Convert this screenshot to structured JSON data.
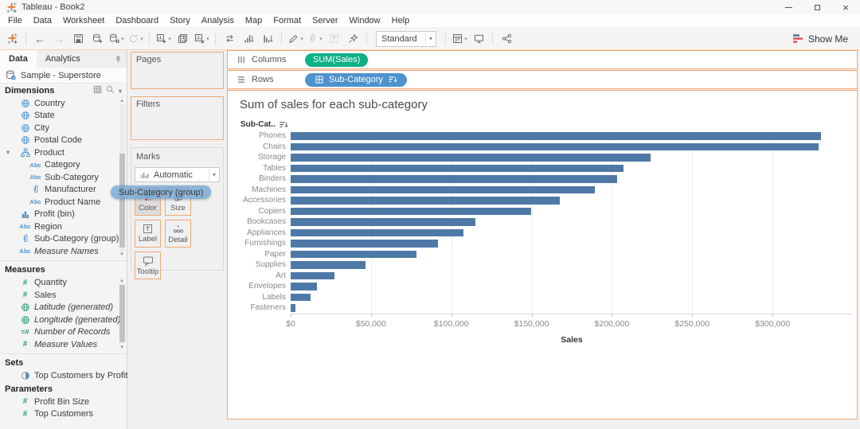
{
  "window": {
    "title": "Tableau - Book2",
    "controls": [
      "minimize-icon",
      "restore-icon",
      "close-icon"
    ]
  },
  "menu": {
    "items": [
      "File",
      "Data",
      "Worksheet",
      "Dashboard",
      "Story",
      "Analysis",
      "Map",
      "Format",
      "Server",
      "Window",
      "Help"
    ]
  },
  "toolbar": {
    "left_buttons": [
      {
        "name": "tableau-home",
        "icon": "tableau-logo-icon"
      },
      {
        "name": "back",
        "icon": "back-icon",
        "sep_before": true
      },
      {
        "name": "forward",
        "icon": "forward-icon",
        "disabled": true
      },
      {
        "name": "save",
        "icon": "save-icon"
      },
      {
        "name": "add-datasource",
        "icon": "add-datasource-icon"
      },
      {
        "name": "pause-updates",
        "icon": "pause-updates-icon",
        "caret": true
      },
      {
        "name": "refresh",
        "icon": "refresh-icon",
        "caret": true,
        "disabled": true
      },
      {
        "name": "new-worksheet",
        "icon": "new-worksheet-icon",
        "caret": true,
        "sep_before": true
      },
      {
        "name": "duplicate-sheet",
        "icon": "duplicate-sheet-icon"
      },
      {
        "name": "clear-sheet",
        "icon": "clear-sheet-icon",
        "caret": true
      },
      {
        "name": "swap-rows-columns",
        "icon": "swap-icon",
        "sep_before": true
      },
      {
        "name": "sort-ascending",
        "icon": "sort-ascending-icon"
      },
      {
        "name": "sort-descending",
        "icon": "sort-descending-icon"
      },
      {
        "name": "highlight",
        "icon": "highlight-icon",
        "caret": true,
        "sep_before": true
      },
      {
        "name": "group-members",
        "icon": "paperclip-icon",
        "caret": true,
        "disabled": true
      },
      {
        "name": "show-mark-labels",
        "icon": "show-mark-labels-icon",
        "disabled": true
      },
      {
        "name": "fix-axes",
        "icon": "pin-icon"
      }
    ],
    "fit_mode": {
      "value": "Standard"
    },
    "right_buttons": [
      {
        "name": "show-hide-cards",
        "icon": "show-hide-cards-icon",
        "caret": true
      },
      {
        "name": "presentation-mode",
        "icon": "presentation-mode-icon"
      },
      {
        "name": "share-workbook",
        "icon": "share-icon",
        "sep_before": true
      }
    ],
    "show_me_label": "Show Me"
  },
  "data_pane": {
    "tabs": [
      {
        "label": "Data",
        "active": true
      },
      {
        "label": "Analytics",
        "active": false
      }
    ],
    "connection": {
      "icon": "datasource-icon",
      "name": "Sample - Superstore"
    },
    "dimensions": {
      "title": "Dimensions",
      "header_icons": [
        "view-as-grid-icon",
        "find-field-icon",
        "pane-menu-icon"
      ],
      "items": [
        {
          "icon": "geographic-icon",
          "label": "Country"
        },
        {
          "icon": "geographic-icon",
          "label": "State"
        },
        {
          "icon": "geographic-icon",
          "label": "City"
        },
        {
          "icon": "geographic-icon",
          "label": "Postal Code"
        },
        {
          "icon": "hierarchy-icon",
          "label": "Product",
          "expander": true
        },
        {
          "icon": "string-icon",
          "label": "Category",
          "indent": true
        },
        {
          "icon": "string-icon",
          "label": "Sub-Category",
          "indent": true
        },
        {
          "icon": "paperclip-blue-icon",
          "label": "Manufacturer",
          "indent": true
        },
        {
          "icon": "string-icon",
          "label": "Product Name",
          "indent": true
        },
        {
          "icon": "bin-icon",
          "label": "Profit (bin)"
        },
        {
          "icon": "string-icon",
          "label": "Region"
        },
        {
          "icon": "paperclip-blue-icon",
          "label": "Sub-Category (group)"
        },
        {
          "icon": "string-icon",
          "label": "Measure Names",
          "italic": true
        }
      ]
    },
    "measures": {
      "title": "Measures",
      "items": [
        {
          "icon": "numeric-icon",
          "label": "Quantity"
        },
        {
          "icon": "numeric-icon",
          "label": "Sales"
        },
        {
          "icon": "geographic-gen-icon",
          "label": "Latitude (generated)",
          "italic": true
        },
        {
          "icon": "geographic-gen-icon",
          "label": "Longitude (generated)",
          "italic": true
        },
        {
          "icon": "auto-numeric-icon",
          "label": "Number of Records",
          "italic": true
        },
        {
          "icon": "numeric-icon",
          "label": "Measure Values",
          "italic": true
        }
      ]
    },
    "sets": {
      "title": "Sets",
      "items": [
        {
          "icon": "set-icon",
          "label": "Top Customers by Profit"
        }
      ]
    },
    "parameters": {
      "title": "Parameters",
      "items": [
        {
          "icon": "numeric-icon",
          "label": "Profit Bin Size"
        },
        {
          "icon": "numeric-icon",
          "label": "Top Customers"
        }
      ]
    }
  },
  "cards": {
    "pages_label": "Pages",
    "filters_label": "Filters",
    "marks": {
      "title": "Marks",
      "type_value": "Automatic",
      "buttons": [
        {
          "name": "color",
          "label": "Color",
          "icon": "color-icon",
          "active": true
        },
        {
          "name": "size",
          "label": "Size",
          "icon": "size-icon"
        },
        {
          "name": "label",
          "label": "Label",
          "icon": "label-icon"
        },
        {
          "name": "detail",
          "label": "Detail",
          "icon": "detail-icon"
        },
        {
          "name": "tooltip",
          "label": "Tooltip",
          "icon": "tooltip-icon"
        }
      ]
    }
  },
  "shelves": {
    "columns": {
      "label": "Columns",
      "pill": {
        "text": "SUM(Sales)",
        "kind": "measure"
      }
    },
    "rows": {
      "label": "Rows",
      "pill": {
        "text": "Sub-Category",
        "kind": "dimension",
        "sorted": true
      }
    }
  },
  "drag_pill": {
    "text": "Sub-Category (group)"
  },
  "view": {
    "title": "Sum of sales for each sub-category",
    "row_header_label": "Sub-Cat.."
  },
  "chart_data": {
    "type": "bar",
    "orientation": "horizontal",
    "title": "Sum of sales for each sub-category",
    "categories": [
      "Phones",
      "Chairs",
      "Storage",
      "Tables",
      "Binders",
      "Machines",
      "Accessories",
      "Copiers",
      "Bookcases",
      "Appliances",
      "Furnishings",
      "Paper",
      "Supplies",
      "Art",
      "Envelopes",
      "Labels",
      "Fasteners"
    ],
    "values": [
      330007,
      328449,
      223844,
      206966,
      203413,
      189239,
      167380,
      149528,
      114880,
      107532,
      91705,
      78479,
      46674,
      27119,
      16476,
      12486,
      3024
    ],
    "xlabel": "Sales",
    "ylabel": "Sub-Category",
    "xlim": [
      0,
      350000
    ],
    "xticks": [
      0,
      50000,
      100000,
      150000,
      200000,
      250000,
      300000
    ],
    "xtick_labels": [
      "$0",
      "$50,000",
      "$100,000",
      "$150,000",
      "$200,000",
      "$250,000",
      "$300,000"
    ],
    "grid": "vertical",
    "bar_color": "#4e79a7",
    "legend": "none",
    "sort": "descending by value"
  },
  "colors": {
    "accent_orange": "#f0a875",
    "bar_blue": "#4e79a7",
    "pill_green": "#0cb185",
    "pill_blue": "#4d93cd",
    "dimension_icon_blue": "#4f93ce",
    "measure_icon_green": "#2e9e78"
  }
}
